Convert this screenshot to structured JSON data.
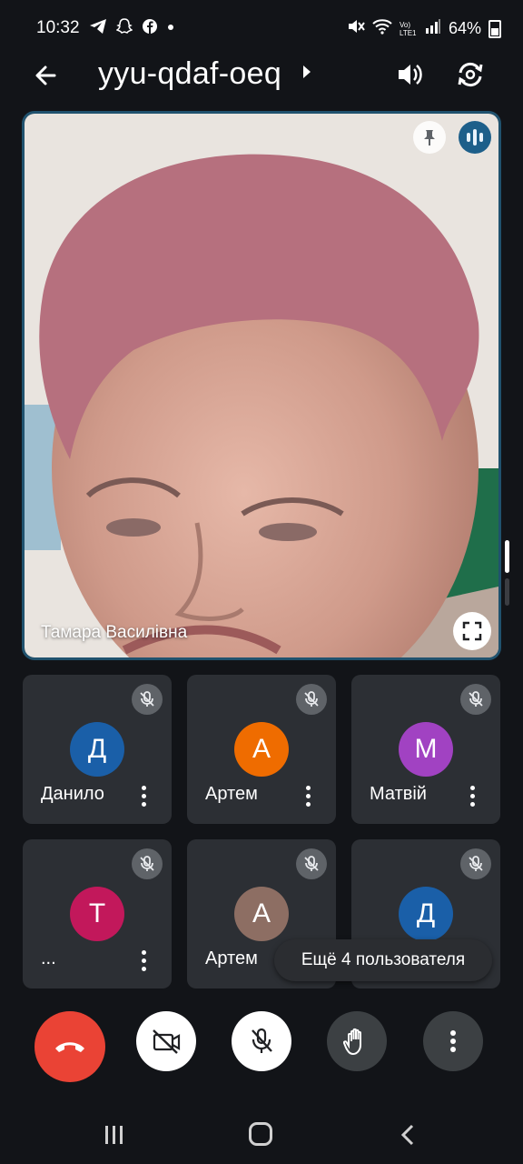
{
  "status_bar": {
    "time": "10:32",
    "notification_icons": [
      "telegram-icon",
      "snapchat-icon",
      "facebook-icon",
      "dot-icon"
    ],
    "battery": "64%",
    "network": "Vo) LTE1"
  },
  "header": {
    "meeting_code": "yyu-qdaf-oeq"
  },
  "main_video": {
    "name": "Тамара Василівна"
  },
  "participants": [
    {
      "name": "Данило",
      "initial": "Д",
      "color": "#1a5fa8"
    },
    {
      "name": "Артем",
      "initial": "А",
      "color": "#ef6c00"
    },
    {
      "name": "Матвій",
      "initial": "М",
      "color": "#a142c2"
    },
    {
      "name": "...",
      "initial": "Т",
      "color": "#c2185b"
    },
    {
      "name": "Артем",
      "initial": "А",
      "color": "#8d6e63"
    },
    {
      "name": "",
      "initial": "Д",
      "color": "#1a5fa8"
    }
  ],
  "more_users": "Ещё 4 пользователя",
  "colors": {
    "background": "#121418",
    "tile": "#2c2f34",
    "hangup": "#ea4335",
    "active_border": "#20526e"
  }
}
